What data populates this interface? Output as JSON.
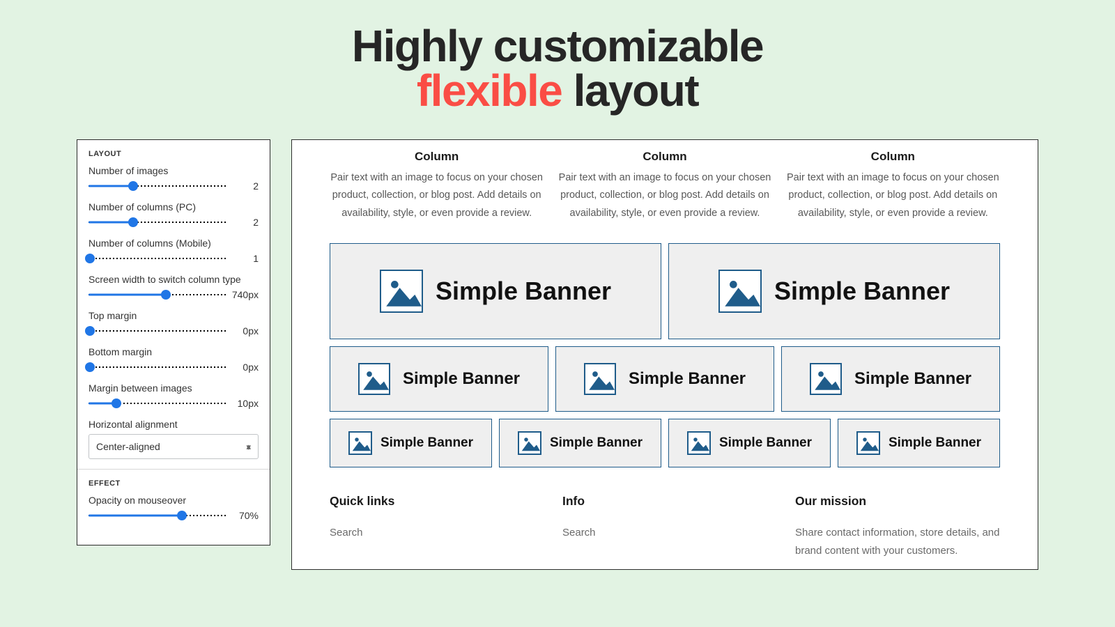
{
  "hero": {
    "line1": "Highly customizable",
    "accent": "flexible",
    "after_accent": "layout"
  },
  "panel": {
    "layout_title": "LAYOUT",
    "effect_title": "EFFECT",
    "controls": {
      "num_images": {
        "label": "Number of images",
        "value": "2",
        "pct": 32
      },
      "cols_pc": {
        "label": "Number of columns (PC)",
        "value": "2",
        "pct": 32
      },
      "cols_mobile": {
        "label": "Number of columns (Mobile)",
        "value": "1",
        "pct": 1
      },
      "breakpoint": {
        "label": "Screen width to switch column type",
        "value": "740px",
        "pct": 56
      },
      "top_margin": {
        "label": "Top margin",
        "value": "0px",
        "pct": 1
      },
      "bottom_margin": {
        "label": "Bottom margin",
        "value": "0px",
        "pct": 1
      },
      "gap": {
        "label": "Margin between images",
        "value": "10px",
        "pct": 20
      },
      "halign": {
        "label": "Horizontal alignment",
        "selected": "Center-aligned"
      },
      "opacity": {
        "label": "Opacity on mouseover",
        "value": "70%",
        "pct": 67
      }
    }
  },
  "preview": {
    "column_title": "Column",
    "column_body": "Pair text with an image to focus on your chosen product, collection, or blog post. Add details on availability, style, or even provide a review.",
    "banner_label": "Simple Banner",
    "footer": {
      "quick_title": "Quick links",
      "quick_item": "Search",
      "info_title": "Info",
      "info_item": "Search",
      "mission_title": "Our mission",
      "mission_body": "Share contact information, store details, and brand content with your customers."
    }
  }
}
